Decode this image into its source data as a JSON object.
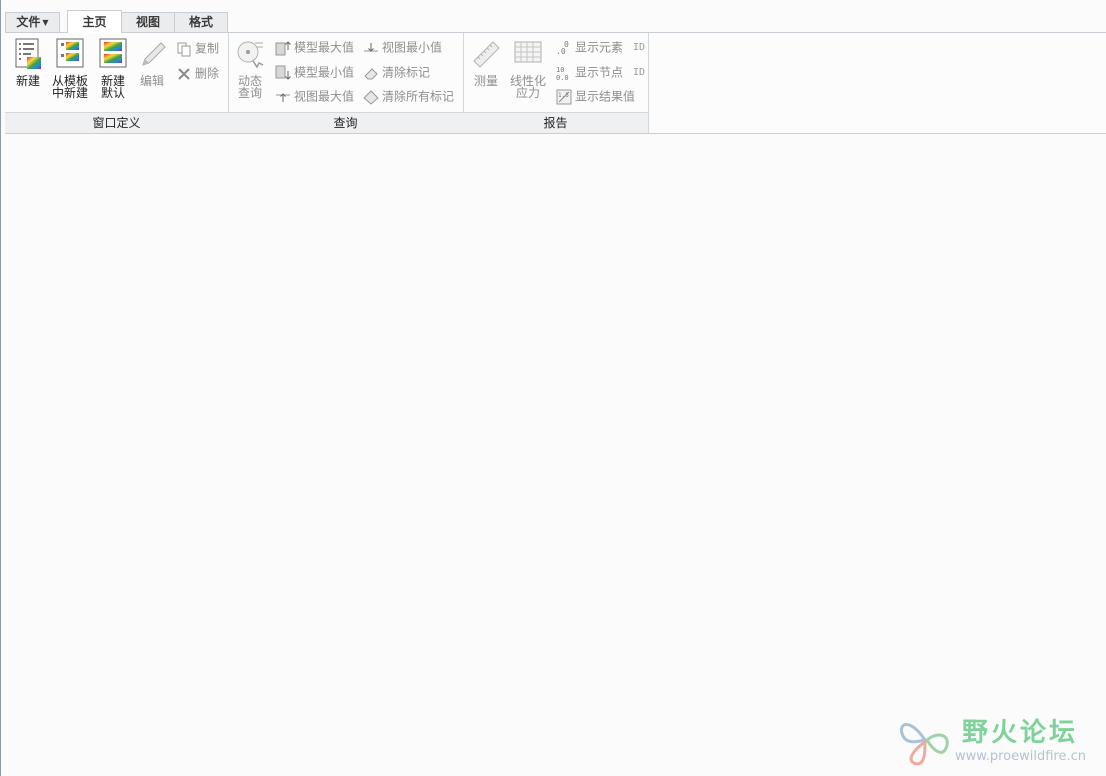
{
  "tabs": [
    {
      "label": "文件"
    },
    {
      "label": "主页"
    },
    {
      "label": "视图"
    },
    {
      "label": "格式"
    }
  ],
  "groups": {
    "window_def": {
      "label": "窗口定义",
      "new_line1": "新建",
      "from_template_line1": "从模板",
      "from_template_line2": "中新建",
      "new_default_line1": "新建",
      "new_default_line2": "默认",
      "edit": "编辑",
      "copy": "复制",
      "delete": "删除"
    },
    "query": {
      "label": "查询",
      "dynamic_line1": "动态",
      "dynamic_line2": "查询",
      "model_max": "模型最大值",
      "model_min": "模型最小值",
      "view_max": "视图最大值",
      "view_min": "视图最小值",
      "clear_marks": "清除标记",
      "clear_all_marks": "清除所有标记"
    },
    "report": {
      "label": "报告",
      "measure": "测量",
      "linear_line1": "线性化",
      "linear_line2": "应力",
      "show_element": "显示元素",
      "show_node": "显示节点",
      "show_result": "显示结果值",
      "id_tag": "ID"
    }
  },
  "watermark": {
    "title": "野火论坛",
    "url": "www.proewildfire.cn"
  }
}
